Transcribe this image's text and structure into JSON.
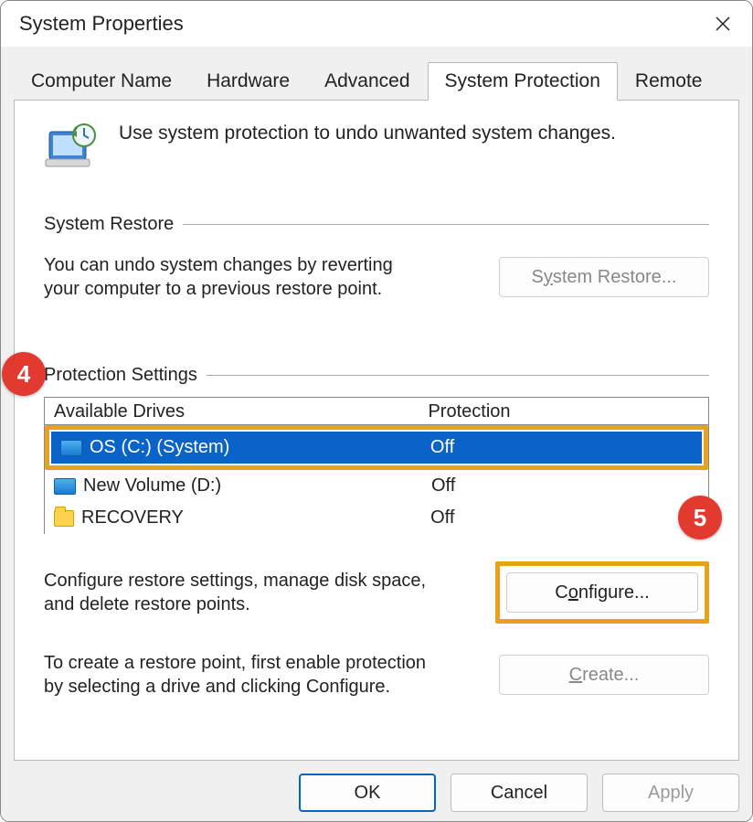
{
  "window": {
    "title": "System Properties"
  },
  "tabs": [
    "Computer Name",
    "Hardware",
    "Advanced",
    "System Protection",
    "Remote"
  ],
  "active_tab": 3,
  "intro": "Use system protection to undo unwanted system changes.",
  "sections": {
    "restore": {
      "title": "System Restore",
      "desc": "You can undo system changes by reverting your computer to a previous restore point.",
      "button_pre": "S",
      "button_u": "y",
      "button_post": "stem Restore..."
    },
    "settings": {
      "title": "Protection Settings",
      "table": {
        "col_drives": "Available Drives",
        "col_protection": "Protection",
        "rows": [
          {
            "icon": "drive",
            "name": "OS (C:) (System)",
            "protection": "Off",
            "selected": true
          },
          {
            "icon": "drive",
            "name": "New Volume (D:)",
            "protection": "Off",
            "selected": false
          },
          {
            "icon": "folder",
            "name": "RECOVERY",
            "protection": "Off",
            "selected": false
          }
        ]
      },
      "configure_desc": "Configure restore settings, manage disk space, and delete restore points.",
      "configure_pre": "C",
      "configure_u": "o",
      "configure_post": "nfigure...",
      "create_desc": "To create a restore point, first enable protection by selecting a drive and clicking Configure.",
      "create_pre": "",
      "create_u": "C",
      "create_post": "reate..."
    }
  },
  "callouts": {
    "step4": "4",
    "step5": "5"
  },
  "footer": {
    "ok": "OK",
    "cancel": "Cancel",
    "apply": "Apply"
  }
}
